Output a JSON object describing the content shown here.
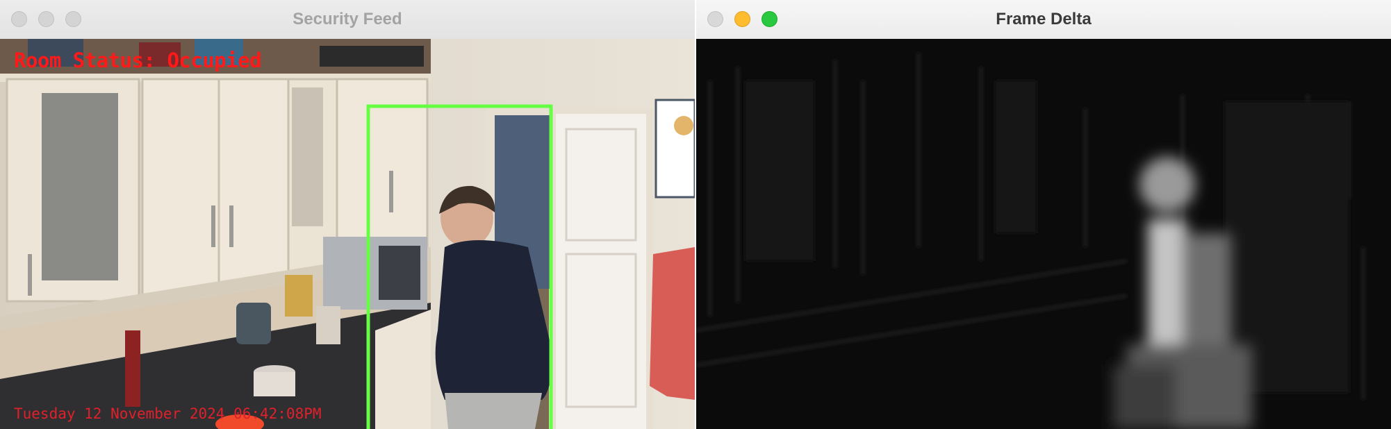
{
  "security_feed": {
    "title": "Security Feed",
    "room_status": "Room Status: Occupied",
    "timestamp": "Tuesday 12 November 2024 06:42:08PM",
    "status_color": "#ff1a1a",
    "box_color": "#66ff44"
  },
  "frame_delta": {
    "title": "Frame Delta"
  }
}
